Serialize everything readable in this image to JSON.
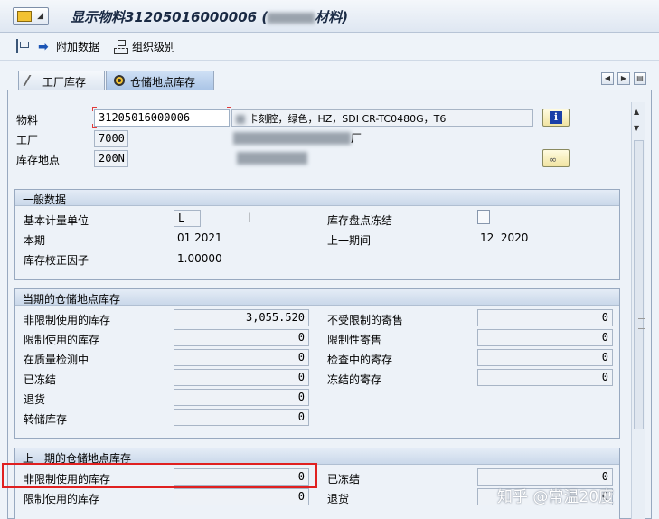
{
  "window": {
    "title_prefix": "显示物料31205016000006 (",
    "title_suffix": "材料)"
  },
  "toolbar": {
    "additional_data": "附加数据",
    "org_levels": "组织级别"
  },
  "tabs": [
    {
      "label": "工厂库存"
    },
    {
      "label": "仓储地点库存"
    }
  ],
  "header": {
    "material_label": "物料",
    "material_value": "31205016000006",
    "material_desc": "卡刻腔，绿色，HZ，SDI CR-TC0480G，T6",
    "plant_label": "工厂",
    "plant_value": "7000",
    "plant_desc_tail": "厂",
    "sloc_label": "库存地点",
    "sloc_value": "200N"
  },
  "general": {
    "title": "一般数据",
    "base_uom_label": "基本计量单位",
    "base_uom_value": "L",
    "base_uom_text": "l",
    "inv_freeze_label": "库存盘点冻结",
    "current_period_label": "本期",
    "current_period_value": "01 2021",
    "prev_period_label": "上一期间",
    "prev_period_value": "12  2020",
    "correction_label": "库存校正因子",
    "correction_value": "1.00000"
  },
  "current": {
    "title": "当期的仓储地点库存",
    "left": [
      {
        "label": "非限制使用的库存",
        "value": "3,055.520"
      },
      {
        "label": "限制使用的库存",
        "value": "0"
      },
      {
        "label": "在质量检测中",
        "value": "0"
      },
      {
        "label": "已冻结",
        "value": "0"
      },
      {
        "label": "退货",
        "value": "0"
      },
      {
        "label": "转储库存",
        "value": "0"
      }
    ],
    "right": [
      {
        "label": "不受限制的寄售",
        "value": "0"
      },
      {
        "label": "限制性寄售",
        "value": "0"
      },
      {
        "label": "检查中的寄存",
        "value": "0"
      },
      {
        "label": "冻结的寄存",
        "value": "0"
      }
    ]
  },
  "previous": {
    "title": "上一期的仓储地点库存",
    "left": [
      {
        "label": "非限制使用的库存",
        "value": "0"
      },
      {
        "label": "限制使用的库存",
        "value": "0"
      }
    ],
    "right": [
      {
        "label": "已冻结",
        "value": "0"
      },
      {
        "label": "退货",
        "value": "0"
      }
    ]
  },
  "watermark": "知乎 @常温20度",
  "colors": {
    "highlight_box": "#e02020",
    "tab_active": "#a9c4e6"
  }
}
